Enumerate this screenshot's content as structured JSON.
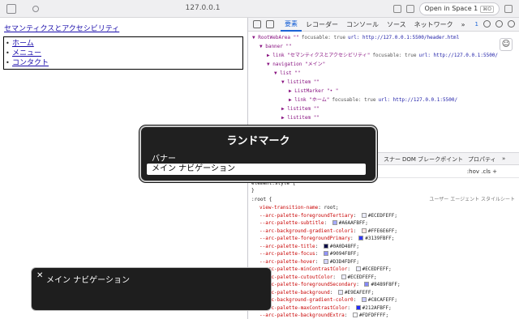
{
  "browser": {
    "url": "127.0.0.1",
    "open_in_label": "Open in Space 1",
    "open_in_key": "⌘O"
  },
  "page": {
    "site_link": "セマンティクスとアクセシビリティ",
    "nav": [
      "ホーム",
      "メニュー",
      "コンタクト"
    ]
  },
  "devtools": {
    "tabs": [
      "要素",
      "レコーダー",
      "コンソール",
      "ソース",
      "ネットワーク"
    ],
    "more": "»",
    "badge": "1",
    "tree": [
      {
        "indent": 0,
        "text": "▼ RootWebArea \"\"",
        "fav": "focusable: true",
        "url": "url: http://127.0.0.1:5500/header.html"
      },
      {
        "indent": 1,
        "text": "▼ banner \"\"",
        "fav": "",
        "url": ""
      },
      {
        "indent": 2,
        "text": "▶ link \"セマンティクスとアクセシビリティ\"",
        "fav": "focusable: true",
        "url": "url: http://127.0.0.1:5500/"
      },
      {
        "indent": 2,
        "text": "▼ navigation \"メイン\"",
        "fav": "",
        "url": ""
      },
      {
        "indent": 3,
        "text": "▼ list \"\"",
        "fav": "",
        "url": ""
      },
      {
        "indent": 4,
        "text": "▼ listitem \"\"",
        "fav": "",
        "url": ""
      },
      {
        "indent": 5,
        "text": "▶ ListMarker \"• \"",
        "fav": "",
        "url": ""
      },
      {
        "indent": 5,
        "text": "▶ link \"ホーム\"",
        "fav": "focusable: true",
        "url": "url: http://127.0.0.1:5500/"
      },
      {
        "indent": 4,
        "text": "▶ listitem \"\"",
        "fav": "",
        "url": ""
      },
      {
        "indent": 4,
        "text": "▶ listitem \"\"",
        "fav": "",
        "url": ""
      }
    ],
    "subtabs": [
      "スナー",
      "DOM ブレークポイント",
      "プロパティ",
      "»"
    ],
    "filter_opts": ":hov  .cls  +",
    "element_style": "element.style {",
    "close_brace": "}",
    "root_selector": ":root {",
    "ua_label": "ユーザー エージェント スタイルシート",
    "props": [
      {
        "name": "view-transition-name",
        "value": "root;",
        "color": ""
      },
      {
        "name": "--arc-palette-foregroundTertiary",
        "value": "#ECEDFEFF;",
        "color": "#ECEDFE"
      },
      {
        "name": "--arc-palette-subtitle",
        "value": "#A6AAFBFF;",
        "color": "#A6AAFB"
      },
      {
        "name": "--arc-background-gradient-color1",
        "value": "#FFE6E6FF;",
        "color": "#FFE6E6"
      },
      {
        "name": "--arc-palette-foregroundPrimary",
        "value": "#3139FBFF;",
        "color": "#3139FB"
      },
      {
        "name": "--arc-palette-title",
        "value": "#0A0D48FF;",
        "color": "#0A0D48"
      },
      {
        "name": "--arc-palette-focus",
        "value": "#9094F8FF;",
        "color": "#9094F8"
      },
      {
        "name": "--arc-palette-hover",
        "value": "#D3D4FDFF;",
        "color": "#D3D4FD"
      },
      {
        "name": "--arc-palette-minContrastColor",
        "value": "#ECEDFEFF;",
        "color": "#ECEDFE"
      },
      {
        "name": "--arc-palette-cutoutColor",
        "value": "#ECEDFEFF;",
        "color": "#ECEDFE"
      },
      {
        "name": "--arc-palette-foregroundSecondary",
        "value": "#8489F8FF;",
        "color": "#8489F8"
      },
      {
        "name": "--arc-palette-background",
        "value": "#E9EAFEFF;",
        "color": "#E9EAFE"
      },
      {
        "name": "--arc-background-gradient-color0",
        "value": "#C8CAFEFF;",
        "color": "#C8CAFE"
      },
      {
        "name": "--arc-palette-maxContrastColor",
        "value": "#212AFBFF;",
        "color": "#212AFB"
      },
      {
        "name": "--arc-palette-backgroundExtra",
        "value": "#FDFDFFFF;",
        "color": "#FDFDFF"
      }
    ]
  },
  "landmarks_dialog": {
    "title": "ランドマーク",
    "items": [
      "バナー"
    ],
    "selected": "メイン ナビゲーション"
  },
  "caption": {
    "close": "✕",
    "text": "メイン ナビゲーション"
  }
}
